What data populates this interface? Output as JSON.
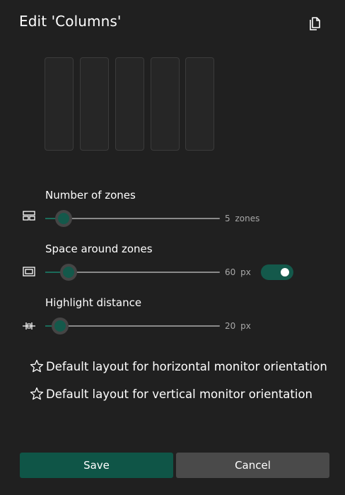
{
  "dialog": {
    "title": "Edit 'Columns'"
  },
  "layout_preview": {
    "zone_count": 5
  },
  "settings": {
    "number_of_zones": {
      "label": "Number of zones",
      "value": "5",
      "unit": "zones",
      "fraction": 0.08
    },
    "space_around_zones": {
      "label": "Space around zones",
      "value": "60",
      "unit": "px",
      "fraction": 0.11,
      "toggle_on": true
    },
    "highlight_distance": {
      "label": "Highlight distance",
      "value": "20",
      "unit": "px",
      "fraction": 0.06
    }
  },
  "defaults": {
    "horizontal": "Default layout for horizontal monitor orientation",
    "vertical": "Default layout for vertical monitor orientation"
  },
  "buttons": {
    "save": "Save",
    "cancel": "Cancel"
  },
  "colors": {
    "background": "#202020",
    "accent": "#14594b",
    "save_button": "#0f5547",
    "cancel_button": "#4a4a4a"
  },
  "icons": {
    "copy": "copy-icon",
    "zones": "zone-grid-icon",
    "space": "rectangle-frame-icon",
    "highlight": "distance-icon",
    "favorite": "star-outline-icon"
  }
}
